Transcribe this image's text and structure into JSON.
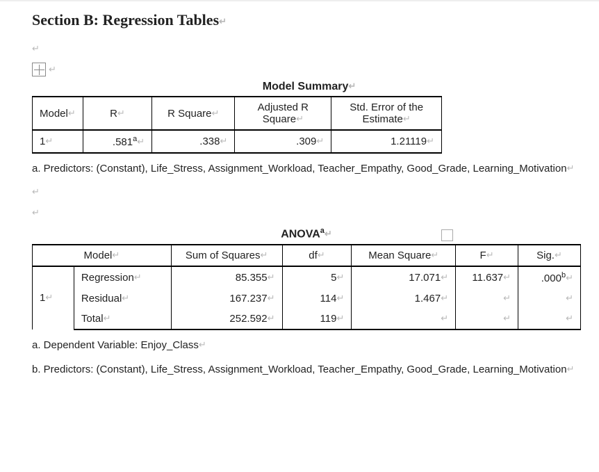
{
  "heading": "Section B: Regression Tables",
  "modelSummary": {
    "title": "Model Summary",
    "headers": {
      "model": "Model",
      "r": "R",
      "rsq": "R Square",
      "adjrsq": "Adjusted R Square",
      "se": "Std. Error of the Estimate"
    },
    "row": {
      "model": "1",
      "r": ".581",
      "rSup": "a",
      "rsq": ".338",
      "adjrsq": ".309",
      "se": "1.21119"
    },
    "noteA": "a. Predictors: (Constant), Life_Stress, Assignment_Workload, Teacher_Empathy, Good_Grade, Learning_Motivation"
  },
  "anova": {
    "title": "ANOVA",
    "titleSup": "a",
    "headers": {
      "model": "Model",
      "ss": "Sum of Squares",
      "df": "df",
      "ms": "Mean Square",
      "f": "F",
      "sig": "Sig."
    },
    "rows": {
      "regression": {
        "label": "Regression",
        "ss": "85.355",
        "df": "5",
        "ms": "17.071",
        "f": "11.637",
        "sig": ".000",
        "sigSup": "b"
      },
      "residual": {
        "label": "Residual",
        "ss": "167.237",
        "df": "114",
        "ms": "1.467",
        "f": "",
        "sig": ""
      },
      "total": {
        "label": "Total",
        "ss": "252.592",
        "df": "119",
        "ms": "",
        "f": "",
        "sig": ""
      }
    },
    "model": "1",
    "noteA": "a. Dependent Variable: Enjoy_Class",
    "noteB": "b. Predictors: (Constant), Life_Stress, Assignment_Workload, Teacher_Empathy, Good_Grade, Learning_Motivation"
  }
}
